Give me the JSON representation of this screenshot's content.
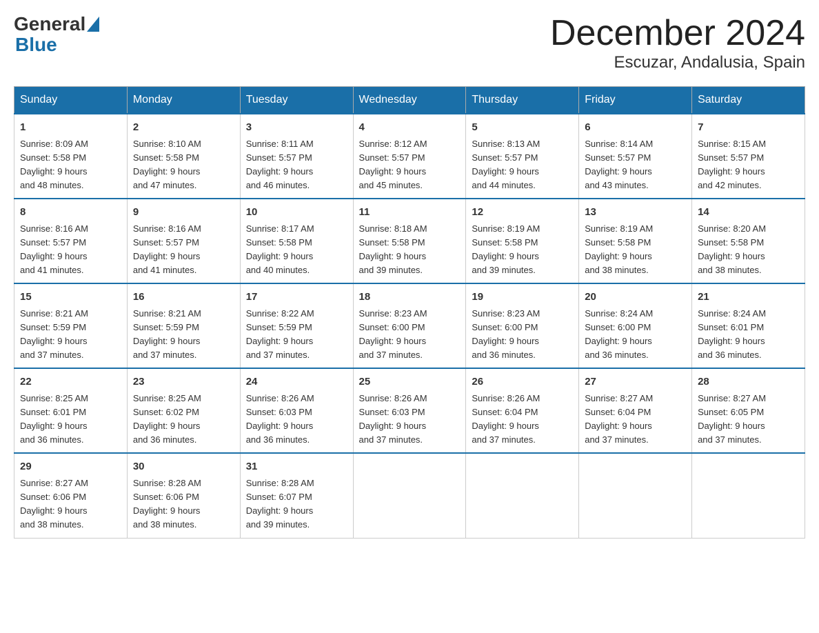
{
  "header": {
    "logo_general": "General",
    "logo_blue": "Blue",
    "month_title": "December 2024",
    "location": "Escuzar, Andalusia, Spain"
  },
  "days_of_week": [
    "Sunday",
    "Monday",
    "Tuesday",
    "Wednesday",
    "Thursday",
    "Friday",
    "Saturday"
  ],
  "weeks": [
    [
      {
        "day": "1",
        "sunrise": "8:09 AM",
        "sunset": "5:58 PM",
        "daylight": "9 hours and 48 minutes."
      },
      {
        "day": "2",
        "sunrise": "8:10 AM",
        "sunset": "5:58 PM",
        "daylight": "9 hours and 47 minutes."
      },
      {
        "day": "3",
        "sunrise": "8:11 AM",
        "sunset": "5:57 PM",
        "daylight": "9 hours and 46 minutes."
      },
      {
        "day": "4",
        "sunrise": "8:12 AM",
        "sunset": "5:57 PM",
        "daylight": "9 hours and 45 minutes."
      },
      {
        "day": "5",
        "sunrise": "8:13 AM",
        "sunset": "5:57 PM",
        "daylight": "9 hours and 44 minutes."
      },
      {
        "day": "6",
        "sunrise": "8:14 AM",
        "sunset": "5:57 PM",
        "daylight": "9 hours and 43 minutes."
      },
      {
        "day": "7",
        "sunrise": "8:15 AM",
        "sunset": "5:57 PM",
        "daylight": "9 hours and 42 minutes."
      }
    ],
    [
      {
        "day": "8",
        "sunrise": "8:16 AM",
        "sunset": "5:57 PM",
        "daylight": "9 hours and 41 minutes."
      },
      {
        "day": "9",
        "sunrise": "8:16 AM",
        "sunset": "5:57 PM",
        "daylight": "9 hours and 41 minutes."
      },
      {
        "day": "10",
        "sunrise": "8:17 AM",
        "sunset": "5:58 PM",
        "daylight": "9 hours and 40 minutes."
      },
      {
        "day": "11",
        "sunrise": "8:18 AM",
        "sunset": "5:58 PM",
        "daylight": "9 hours and 39 minutes."
      },
      {
        "day": "12",
        "sunrise": "8:19 AM",
        "sunset": "5:58 PM",
        "daylight": "9 hours and 39 minutes."
      },
      {
        "day": "13",
        "sunrise": "8:19 AM",
        "sunset": "5:58 PM",
        "daylight": "9 hours and 38 minutes."
      },
      {
        "day": "14",
        "sunrise": "8:20 AM",
        "sunset": "5:58 PM",
        "daylight": "9 hours and 38 minutes."
      }
    ],
    [
      {
        "day": "15",
        "sunrise": "8:21 AM",
        "sunset": "5:59 PM",
        "daylight": "9 hours and 37 minutes."
      },
      {
        "day": "16",
        "sunrise": "8:21 AM",
        "sunset": "5:59 PM",
        "daylight": "9 hours and 37 minutes."
      },
      {
        "day": "17",
        "sunrise": "8:22 AM",
        "sunset": "5:59 PM",
        "daylight": "9 hours and 37 minutes."
      },
      {
        "day": "18",
        "sunrise": "8:23 AM",
        "sunset": "6:00 PM",
        "daylight": "9 hours and 37 minutes."
      },
      {
        "day": "19",
        "sunrise": "8:23 AM",
        "sunset": "6:00 PM",
        "daylight": "9 hours and 36 minutes."
      },
      {
        "day": "20",
        "sunrise": "8:24 AM",
        "sunset": "6:00 PM",
        "daylight": "9 hours and 36 minutes."
      },
      {
        "day": "21",
        "sunrise": "8:24 AM",
        "sunset": "6:01 PM",
        "daylight": "9 hours and 36 minutes."
      }
    ],
    [
      {
        "day": "22",
        "sunrise": "8:25 AM",
        "sunset": "6:01 PM",
        "daylight": "9 hours and 36 minutes."
      },
      {
        "day": "23",
        "sunrise": "8:25 AM",
        "sunset": "6:02 PM",
        "daylight": "9 hours and 36 minutes."
      },
      {
        "day": "24",
        "sunrise": "8:26 AM",
        "sunset": "6:03 PM",
        "daylight": "9 hours and 36 minutes."
      },
      {
        "day": "25",
        "sunrise": "8:26 AM",
        "sunset": "6:03 PM",
        "daylight": "9 hours and 37 minutes."
      },
      {
        "day": "26",
        "sunrise": "8:26 AM",
        "sunset": "6:04 PM",
        "daylight": "9 hours and 37 minutes."
      },
      {
        "day": "27",
        "sunrise": "8:27 AM",
        "sunset": "6:04 PM",
        "daylight": "9 hours and 37 minutes."
      },
      {
        "day": "28",
        "sunrise": "8:27 AM",
        "sunset": "6:05 PM",
        "daylight": "9 hours and 37 minutes."
      }
    ],
    [
      {
        "day": "29",
        "sunrise": "8:27 AM",
        "sunset": "6:06 PM",
        "daylight": "9 hours and 38 minutes."
      },
      {
        "day": "30",
        "sunrise": "8:28 AM",
        "sunset": "6:06 PM",
        "daylight": "9 hours and 38 minutes."
      },
      {
        "day": "31",
        "sunrise": "8:28 AM",
        "sunset": "6:07 PM",
        "daylight": "9 hours and 39 minutes."
      },
      null,
      null,
      null,
      null
    ]
  ],
  "labels": {
    "sunrise": "Sunrise:",
    "sunset": "Sunset:",
    "daylight": "Daylight:"
  }
}
